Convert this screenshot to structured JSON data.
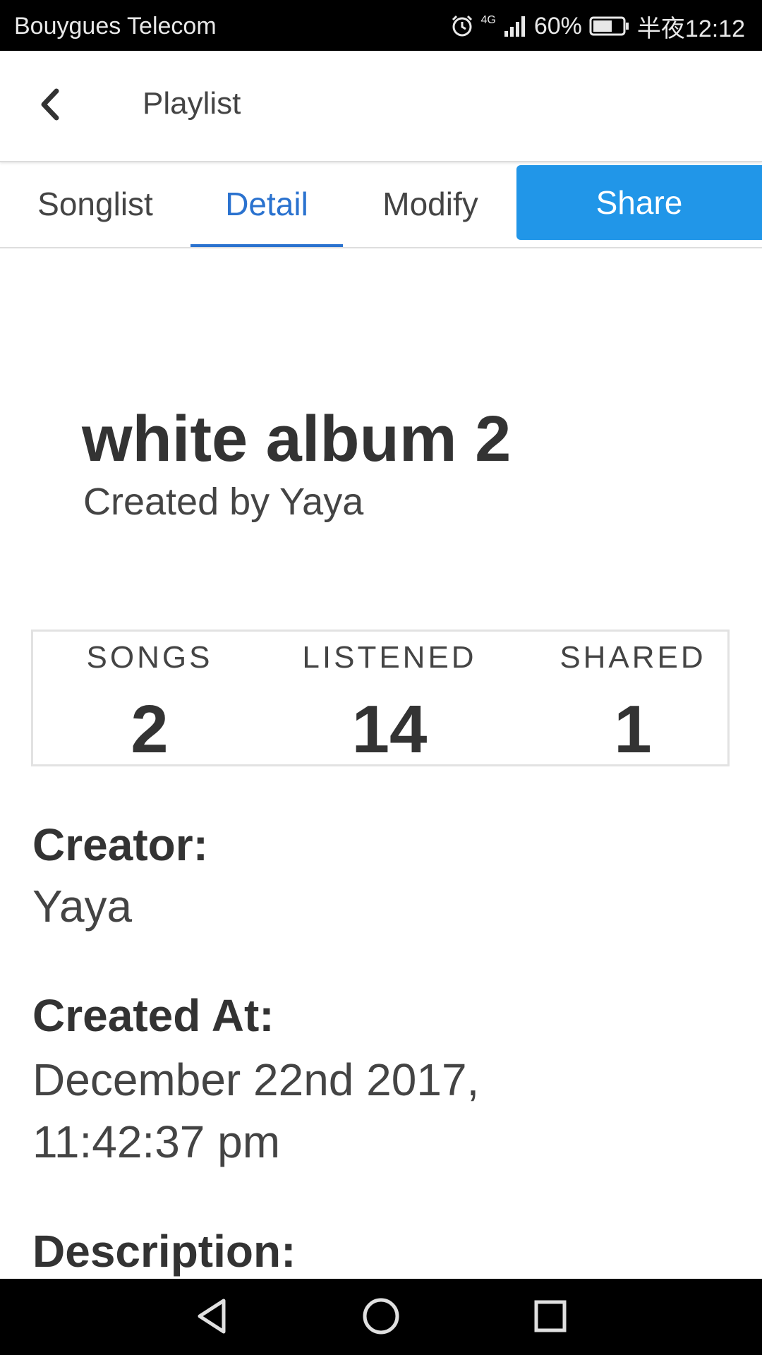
{
  "status_bar": {
    "carrier": "Bouygues Telecom",
    "network": "4G",
    "battery": "60%",
    "time": "半夜12:12",
    "icons": [
      "alarm-icon",
      "signal-icon",
      "battery-icon"
    ]
  },
  "header": {
    "back_icon": "chevron-left-icon",
    "title": "Playlist"
  },
  "tabs": {
    "items": [
      {
        "label": "Songlist",
        "active": false
      },
      {
        "label": "Detail",
        "active": true
      },
      {
        "label": "Modify",
        "active": false
      }
    ],
    "share_label": "Share",
    "active_color": "#2a72cf",
    "share_color": "#2196e8"
  },
  "playlist": {
    "title": "white album 2",
    "subtitle": "Created by Yaya"
  },
  "stats": [
    {
      "label": "SONGS",
      "value": "2"
    },
    {
      "label": "LISTENED",
      "value": "14"
    },
    {
      "label": "SHARED",
      "value": "1"
    }
  ],
  "details": {
    "creator_label": "Creator:",
    "creator_value": "Yaya",
    "created_label": "Created At:",
    "created_value_line1": "December 22nd 2017,",
    "created_value_line2": "11:42:37 pm",
    "description_label": "Description:"
  },
  "nav_bar": {
    "icons": [
      "back-triangle-icon",
      "home-circle-icon",
      "recent-square-icon"
    ]
  }
}
